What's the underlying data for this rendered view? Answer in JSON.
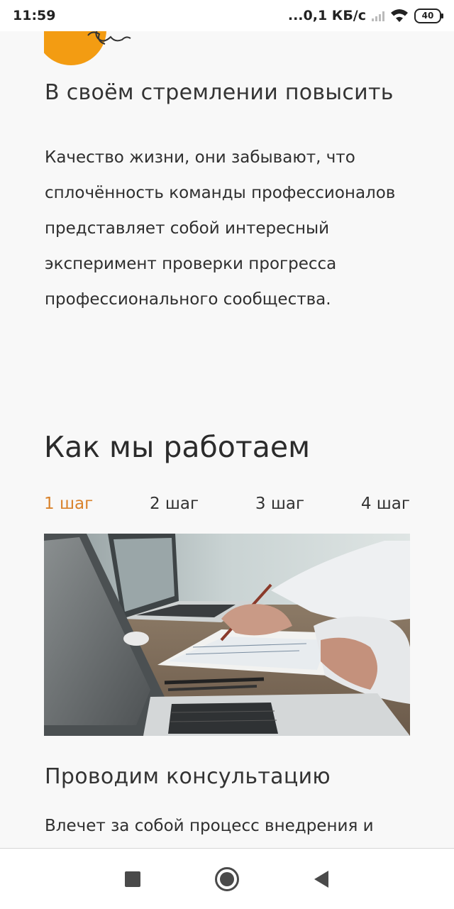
{
  "status_bar": {
    "time": "11:59",
    "network_speed": "...0,1 КБ/с",
    "battery_level": "40"
  },
  "intro_card": {
    "title": "В своём стремлении повысить",
    "body": "Качество жизни, они забывают, что сплочённость команды профессионалов представляет собой интересный эксперимент проверки прогресса профессионального сообщества."
  },
  "how_we_work": {
    "heading": "Как мы работаем",
    "tabs": [
      {
        "label": "1 шаг"
      },
      {
        "label": "2 шаг"
      },
      {
        "label": "3 шаг"
      },
      {
        "label": "4 шаг"
      }
    ],
    "active_tab": 0,
    "step": {
      "title": "Проводим консультацию",
      "text": "Влечет за собой процесс внедрения и"
    }
  },
  "colors": {
    "accent": "#d9822b",
    "deco_circle": "#f39c12",
    "background": "#f8f8f8"
  },
  "icons": {
    "recents": "square-stop-icon",
    "home": "circle-home-icon",
    "back": "triangle-back-icon"
  }
}
